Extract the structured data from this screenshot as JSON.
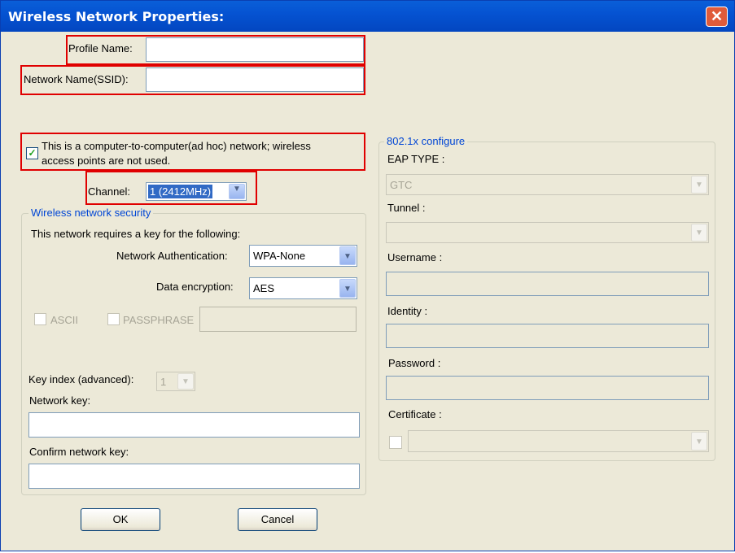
{
  "window": {
    "title": "Wireless Network Properties:"
  },
  "profile": {
    "label": "Profile Name:",
    "value": ""
  },
  "ssid": {
    "label": "Network Name(SSID):",
    "value": ""
  },
  "adhoc": {
    "checked": true,
    "line1": "This is a computer-to-computer(ad hoc) network; wireless",
    "line2": "access points are not used."
  },
  "channel": {
    "label": "Channel:",
    "value": "1  (2412MHz)"
  },
  "security": {
    "title": "Wireless network security",
    "intro": "This network requires a key for the following:",
    "auth_label": "Network Authentication:",
    "auth_value": "WPA-None",
    "enc_label": "Data encryption:",
    "enc_value": "AES",
    "ascii_label": "ASCII",
    "passphrase_label": "PASSPHRASE",
    "key_index_label": "Key index (advanced):",
    "key_index_value": "1",
    "network_key_label": "Network key:",
    "confirm_key_label": "Confirm network key:"
  },
  "dot1x": {
    "title": "802.1x configure",
    "eap_label": "EAP TYPE :",
    "eap_value": "GTC",
    "tunnel_label": "Tunnel :",
    "username_label": "Username :",
    "identity_label": "Identity :",
    "password_label": "Password :",
    "certificate_label": "Certificate :"
  },
  "buttons": {
    "ok": "OK",
    "cancel": "Cancel"
  },
  "colors": {
    "title_bar": "#0553d2",
    "highlight_border": "#e00000",
    "group_label": "#0046d5"
  }
}
